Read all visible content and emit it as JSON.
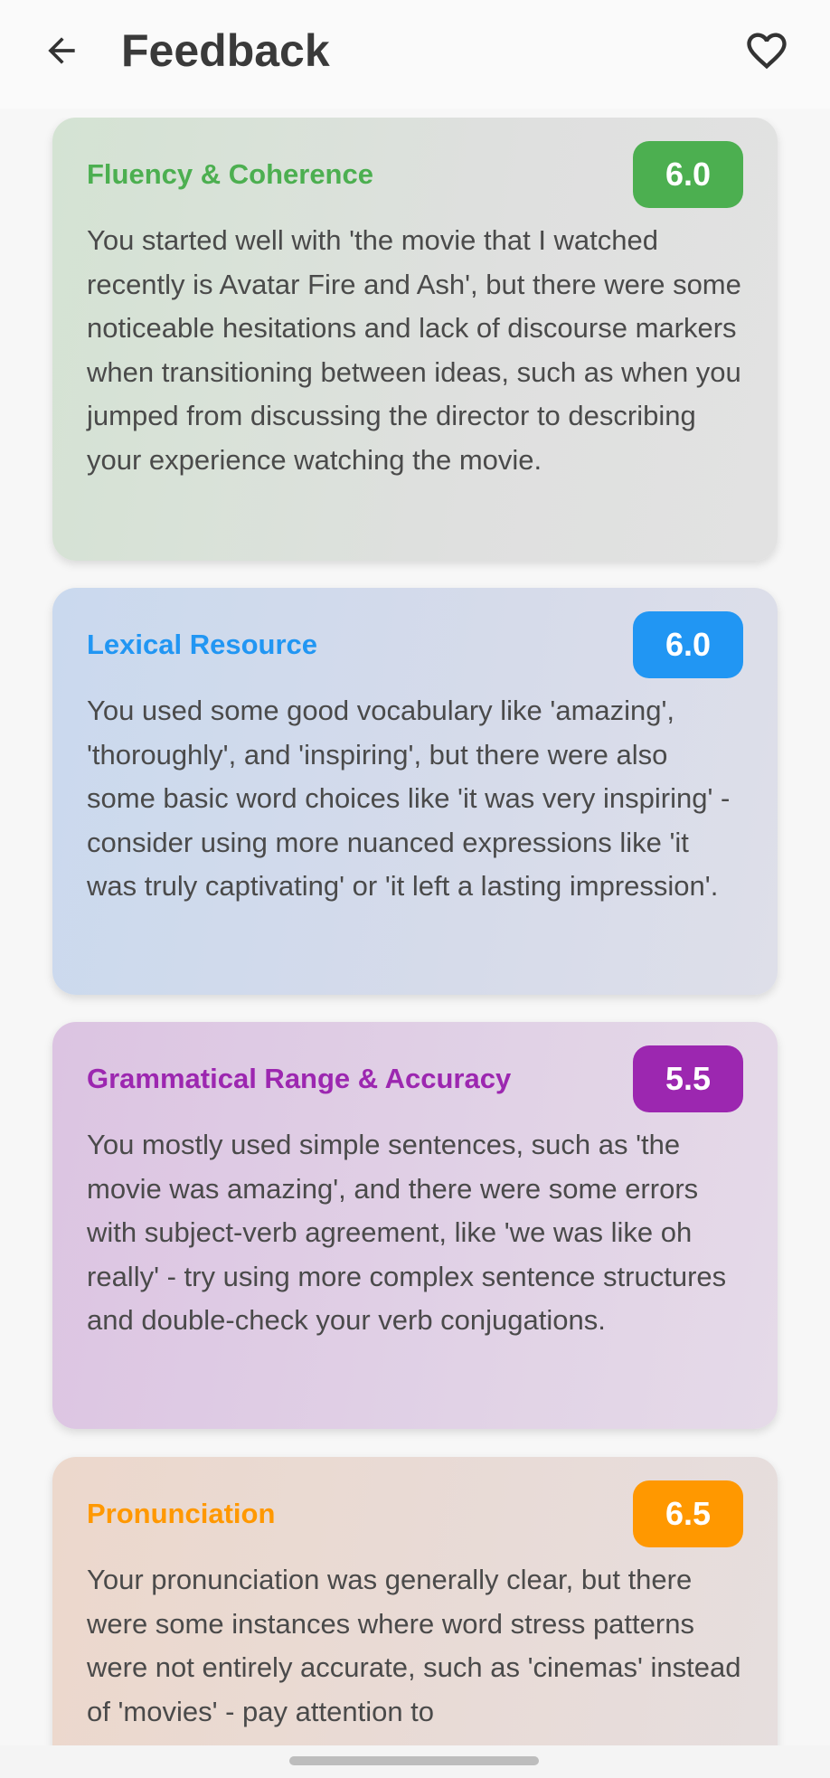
{
  "header": {
    "title": "Feedback",
    "back_icon": "arrow-left-icon",
    "favorite_icon": "heart-outline-icon"
  },
  "cards": [
    {
      "id": "fluency",
      "title": "Fluency & Coherence",
      "score": "6.0",
      "accent": "#4caf50",
      "text": "You started well with 'the movie that I watched recently is Avatar Fire and Ash', but there were some noticeable hesitations and lack of discourse markers when transitioning between ideas, such as when you jumped from discussing the director to describing your experience watching the movie."
    },
    {
      "id": "lexical",
      "title": "Lexical Resource",
      "score": "6.0",
      "accent": "#2196f3",
      "text": "You used some good vocabulary like 'amazing', 'thoroughly', and 'inspiring', but there were also some basic word choices like 'it was very inspiring' - consider using more nuanced expressions like 'it was truly captivating' or 'it left a lasting impression'."
    },
    {
      "id": "grammar",
      "title": "Grammatical Range & Accuracy",
      "score": "5.5",
      "accent": "#9c27b0",
      "text": "You mostly used simple sentences, such as 'the movie was amazing', and there were some errors with subject-verb agreement, like 'we was like oh really' - try using more complex sentence structures and double-check your verb conjugations."
    },
    {
      "id": "pronunciation",
      "title": "Pronunciation",
      "score": "6.5",
      "accent": "#ff9800",
      "text": "Your pronunciation was generally clear, but there were some instances where word stress patterns were not entirely accurate, such as 'cinemas' instead of 'movies' - pay attention to"
    }
  ]
}
